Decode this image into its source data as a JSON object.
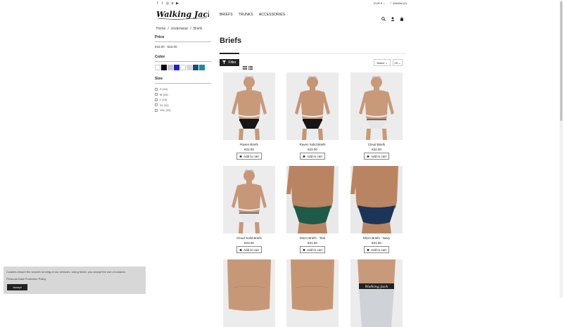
{
  "topbar": {
    "social_icons": [
      "facebook-icon",
      "twitter-icon",
      "instagram-icon",
      "pinterest-icon",
      "youtube-icon"
    ],
    "currency": "EUR € ⌄",
    "wishlist": "♡ Wishlist (0)"
  },
  "header": {
    "logo_text": "Walking Jack",
    "nav": [
      "BRIEFS",
      "TRUNKS",
      "ACCESSORIES"
    ],
    "icons": [
      "search-icon",
      "user-icon",
      "cart-icon"
    ]
  },
  "breadcrumb": [
    "Home",
    "/",
    "Underwear",
    "/",
    "Briefs"
  ],
  "sidebar": {
    "price_title": "Price",
    "price_range": "€15.00 - €23.00",
    "color_title": "Color",
    "colors": [
      "#ffffff",
      "#000000",
      "#c9c9c9",
      "#1e22c9",
      "#ffffff",
      "#d8d8d8",
      "#0b4f8a",
      "#1a8f9a"
    ],
    "size_title": "Size",
    "sizes": [
      "S (14)",
      "M (15)",
      "L (13)",
      "XL (11)",
      "XXL (12)"
    ]
  },
  "main": {
    "title": "Briefs",
    "filter_label": "Filter",
    "sort_label": "Select ⌄",
    "count_label": "16 ⌄"
  },
  "products": [
    {
      "name": "Raven Briefs",
      "price": "€22.00",
      "cart": "Add to cart",
      "brief_color": "#15151a",
      "band": "#15151a",
      "skin": "#c89a7a"
    },
    {
      "name": "Raven Solid Briefs",
      "price": "€22.00",
      "cart": "Add to cart",
      "brief_color": "#15151a",
      "band": "#15151a",
      "skin": "#c59576"
    },
    {
      "name": "Cloud Briefs",
      "price": "€22.00",
      "cart": "Add to cart",
      "brief_color": "#e6e6ea",
      "band": "#6b6b70",
      "skin": "#c89a7a"
    },
    {
      "name": "Cloud Solid Briefs",
      "price": "€23.00",
      "cart": "Add to cart",
      "brief_color": "#e9e9ec",
      "band": "#777777",
      "skin": "#c7977a"
    },
    {
      "name": "Micro Briefs - Teal",
      "price": "€21.00",
      "cart": "Add to cart",
      "brief_color": "#1f5a48",
      "band": "#1f5a48",
      "skin": "#b98462"
    },
    {
      "name": "Micro Briefs - Navy",
      "price": "€21.00",
      "cart": "Add to cart",
      "brief_color": "#1a3557",
      "band": "#1a3557",
      "skin": "#b98462"
    }
  ],
  "bottom_row_band_text": "Walking Jack",
  "cookie": {
    "message": "Cookies ensure the smooth running of our services. Using these, you accept the use of cookies.",
    "policy": "Personal Data Protection Policy",
    "accept": "Accept"
  }
}
